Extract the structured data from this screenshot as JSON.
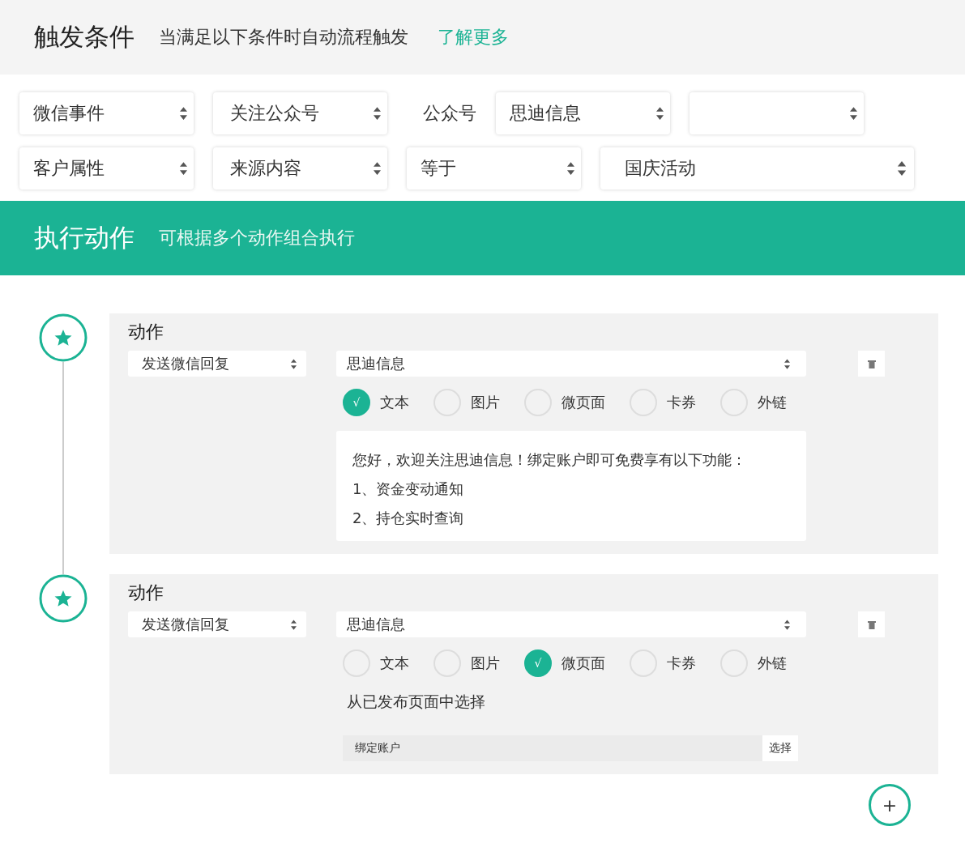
{
  "trigger": {
    "title": "触发条件",
    "subtitle": "当满足以下条件时自动流程触发",
    "link": "了解更多",
    "rows": [
      [
        {
          "kind": "select",
          "value": "微信事件"
        },
        {
          "kind": "select",
          "value": "关注公众号"
        },
        {
          "kind": "label",
          "value": "公众号"
        },
        {
          "kind": "select",
          "value": "思迪信息"
        },
        {
          "kind": "select"
        }
      ],
      [
        {
          "kind": "select",
          "value": "客户属性"
        },
        {
          "kind": "select",
          "value": "来源内容"
        },
        {
          "kind": "select",
          "value": "等于"
        },
        {
          "kind": "wide_select",
          "value": "国庆活动"
        }
      ]
    ]
  },
  "action_header": {
    "title": "执行动作",
    "subtitle": "可根据多个动作组合执行"
  },
  "check_mark": "√",
  "actions": [
    {
      "title": "动作",
      "action_select": "发送微信回复",
      "account_select": "思迪信息",
      "content_types": [
        {
          "label": "文本",
          "selected": true
        },
        {
          "label": "图片",
          "selected": false
        },
        {
          "label": "微页面",
          "selected": false
        },
        {
          "label": "卡券",
          "selected": false
        },
        {
          "label": "外链",
          "selected": false
        }
      ],
      "kind": "text",
      "lines": [
        "您好，欢迎关注思迪信息！绑定账户即可免费享有以下功能：",
        "1、资金变动通知",
        "2、持仓实时查询"
      ]
    },
    {
      "title": "动作",
      "action_select": "发送微信回复",
      "account_select": "思迪信息",
      "content_types": [
        {
          "label": "文本",
          "selected": false
        },
        {
          "label": "图片",
          "selected": false
        },
        {
          "label": "微页面",
          "selected": true
        },
        {
          "label": "卡券",
          "selected": false
        },
        {
          "label": "外链",
          "selected": false
        }
      ],
      "kind": "page",
      "prompt": "从已发布页面中选择",
      "page_value": "绑定账户",
      "choose_button": "选择"
    }
  ],
  "add_button": "+"
}
